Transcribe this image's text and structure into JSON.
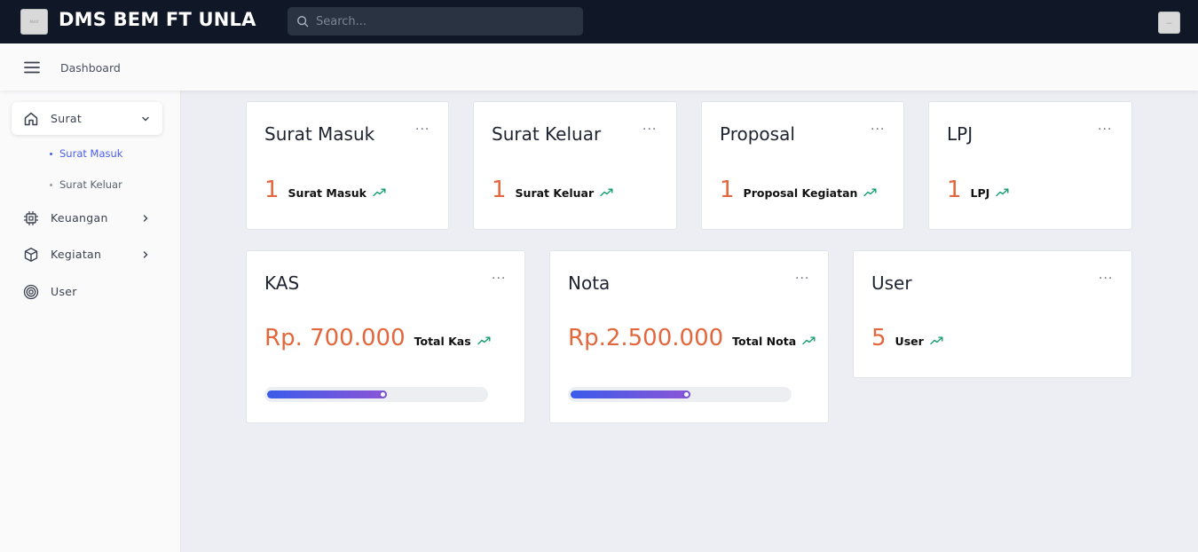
{
  "header": {
    "logo_text": "Motif",
    "app_title": "DMS BEM FT UNLA",
    "search_placeholder": "Search...",
    "avatar_text": "user"
  },
  "subheader": {
    "breadcrumb": "Dashboard"
  },
  "sidebar": {
    "items": [
      {
        "label": "Surat",
        "icon": "home-icon",
        "expanded": true
      },
      {
        "label": "Keuangan",
        "icon": "cpu-chip-icon"
      },
      {
        "label": "Kegiatan",
        "icon": "cube-icon"
      },
      {
        "label": "User",
        "icon": "target-icon"
      }
    ],
    "subitems": [
      {
        "label": "Surat Masuk",
        "active": true
      },
      {
        "label": "Surat Keluar",
        "active": false
      }
    ]
  },
  "cards": {
    "menu": "···",
    "surat_masuk": {
      "title": "Surat Masuk",
      "value": "1",
      "label": "Surat Masuk"
    },
    "surat_keluar": {
      "title": "Surat Keluar",
      "value": "1",
      "label": "Surat Keluar"
    },
    "proposal": {
      "title": "Proposal",
      "value": "1",
      "label": "Proposal Kegiatan"
    },
    "lpj": {
      "title": "LPJ",
      "value": "1",
      "label": "LPJ"
    },
    "kas": {
      "title": "KAS",
      "value": "Rp. 700.000",
      "label": "Total Kas",
      "progress": 0.55
    },
    "nota": {
      "title": "Nota",
      "value": "Rp.2.500.000",
      "label": "Total Nota",
      "progress": 0.55
    },
    "user": {
      "title": "User",
      "value": "5",
      "label": "User"
    }
  },
  "colors": {
    "topbar": "#101828",
    "accent": "#4b5ee8",
    "metric": "#e2673d",
    "trend": "#14a06e"
  }
}
